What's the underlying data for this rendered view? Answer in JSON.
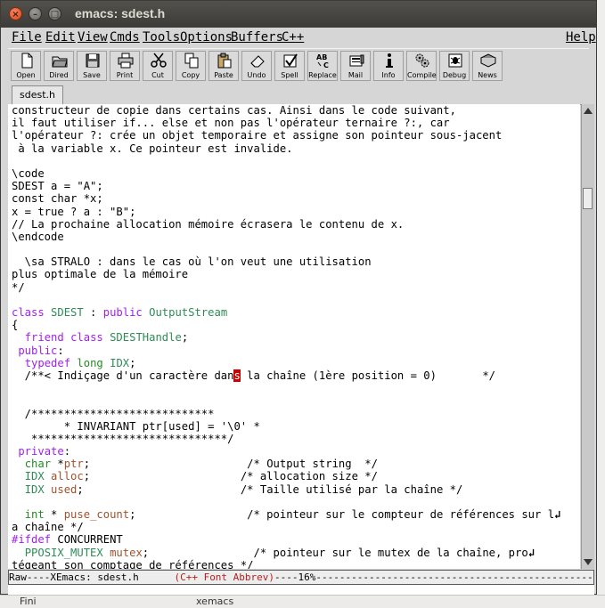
{
  "window": {
    "title": "emacs: sdest.h",
    "close_glyph": "×",
    "min_glyph": "–",
    "max_glyph": "□"
  },
  "menu": [
    {
      "label": "File"
    },
    {
      "label": "Edit"
    },
    {
      "label": "View"
    },
    {
      "label": "Cmds"
    },
    {
      "label": "Tools"
    },
    {
      "label": "Options"
    },
    {
      "label": "Buffers"
    },
    {
      "label": "C++"
    }
  ],
  "menu_help": "Help",
  "toolbar": [
    {
      "label": "Open",
      "icon": "document-icon"
    },
    {
      "label": "Dired",
      "icon": "folder-icon"
    },
    {
      "label": "Save",
      "icon": "floppy-icon"
    },
    {
      "label": "Print",
      "icon": "printer-icon"
    },
    {
      "label": "Cut",
      "icon": "scissors-icon"
    },
    {
      "label": "Copy",
      "icon": "copy-icon"
    },
    {
      "label": "Paste",
      "icon": "clipboard-icon"
    },
    {
      "label": "Undo",
      "icon": "eraser-icon"
    },
    {
      "label": "Spell",
      "icon": "spellcheck-icon"
    },
    {
      "label": "Replace",
      "icon": "replace-icon"
    },
    {
      "label": "Mail",
      "icon": "mail-icon"
    },
    {
      "label": "Info",
      "icon": "info-icon"
    },
    {
      "label": "Compile",
      "icon": "gears-icon"
    },
    {
      "label": "Debug",
      "icon": "bug-icon"
    },
    {
      "label": "News",
      "icon": "news-icon"
    }
  ],
  "tab": {
    "label": "sdest.h"
  },
  "editor": {
    "lines": [
      [
        {
          "t": "constructeur de copie dans certains cas. Ainsi dans le code suivant,"
        }
      ],
      [
        {
          "t": "il faut utiliser if... else et non pas l'opérateur ternaire ?:, car"
        }
      ],
      [
        {
          "t": "l'opérateur ?: crée un objet temporaire et assigne son pointeur sous-jacent"
        }
      ],
      [
        {
          "t": " à la variable x. Ce pointeur est invalide."
        }
      ],
      [
        {
          "t": ""
        }
      ],
      [
        {
          "t": "\\code"
        }
      ],
      [
        {
          "t": "SDEST a = \"A\";"
        }
      ],
      [
        {
          "t": "const char *x;"
        }
      ],
      [
        {
          "t": "x = true ? a : \"B\";"
        }
      ],
      [
        {
          "t": "// La prochaine allocation mémoire écrasera le contenu de x."
        }
      ],
      [
        {
          "t": "\\endcode"
        }
      ],
      [
        {
          "t": ""
        }
      ],
      [
        {
          "t": "  \\sa STRALO : dans le cas où l'on veut une utilisation"
        }
      ],
      [
        {
          "t": "plus optimale de la mémoire"
        }
      ],
      [
        {
          "t": "*/"
        }
      ],
      [
        {
          "t": ""
        }
      ],
      [
        {
          "t": "class",
          "c": "kw"
        },
        {
          "t": " "
        },
        {
          "t": "SDEST",
          "c": "tp"
        },
        {
          "t": " : "
        },
        {
          "t": "public",
          "c": "kw"
        },
        {
          "t": " "
        },
        {
          "t": "OutputStream",
          "c": "tp"
        }
      ],
      [
        {
          "t": "{"
        }
      ],
      [
        {
          "t": "  "
        },
        {
          "t": "friend",
          "c": "kw"
        },
        {
          "t": " "
        },
        {
          "t": "class",
          "c": "kw"
        },
        {
          "t": " "
        },
        {
          "t": "SDESTHandle",
          "c": "tp"
        },
        {
          "t": ";"
        }
      ],
      [
        {
          "t": " "
        },
        {
          "t": "public",
          "c": "kw"
        },
        {
          "t": ":"
        }
      ],
      [
        {
          "t": "  "
        },
        {
          "t": "typedef",
          "c": "kw"
        },
        {
          "t": " "
        },
        {
          "t": "long",
          "c": "ty"
        },
        {
          "t": " "
        },
        {
          "t": "IDX",
          "c": "tp"
        },
        {
          "t": ";"
        }
      ],
      [
        {
          "t": "  /**< Indiçage d'un caractère dan"
        },
        {
          "t": "s",
          "cursor": true
        },
        {
          "t": " la chaîne (1ère position = 0)       */"
        }
      ],
      [
        {
          "t": ""
        }
      ],
      [
        {
          "t": ""
        }
      ],
      [
        {
          "t": "  /****************************"
        }
      ],
      [
        {
          "t": "        * INVARIANT ptr[used] = '\\0' *"
        }
      ],
      [
        {
          "t": "   ******************************/"
        }
      ],
      [
        {
          "t": " "
        },
        {
          "t": "private",
          "c": "kw"
        },
        {
          "t": ":"
        }
      ],
      [
        {
          "t": "  "
        },
        {
          "t": "char",
          "c": "ty"
        },
        {
          "t": " *"
        },
        {
          "t": "ptr",
          "c": "vr"
        },
        {
          "t": ";                        /* Output string  */"
        }
      ],
      [
        {
          "t": "  "
        },
        {
          "t": "IDX",
          "c": "tp"
        },
        {
          "t": " "
        },
        {
          "t": "alloc",
          "c": "vr"
        },
        {
          "t": ";                       /* allocation size */"
        }
      ],
      [
        {
          "t": "  "
        },
        {
          "t": "IDX",
          "c": "tp"
        },
        {
          "t": " "
        },
        {
          "t": "used",
          "c": "vr"
        },
        {
          "t": ";                        /* Taille utilisé par la chaîne */"
        }
      ],
      [
        {
          "t": ""
        }
      ],
      [
        {
          "t": "  "
        },
        {
          "t": "int",
          "c": "ty"
        },
        {
          "t": " * "
        },
        {
          "t": "puse_count",
          "c": "vr"
        },
        {
          "t": ";                 /* pointeur sur le compteur de références sur l"
        },
        {
          "t": "↲",
          "wrap": true
        }
      ],
      [
        {
          "t": "a chaîne */"
        }
      ],
      [
        {
          "t": "#ifdef",
          "c": "kw"
        },
        {
          "t": " CONCURRENT"
        }
      ],
      [
        {
          "t": "  "
        },
        {
          "t": "PPOSIX_MUTEX",
          "c": "tp"
        },
        {
          "t": " "
        },
        {
          "t": "mutex",
          "c": "vr"
        },
        {
          "t": ";                /* pointeur sur le mutex de la chaîne, pro"
        },
        {
          "t": "↲",
          "wrap": true
        }
      ],
      [
        {
          "t": "tégeant son comptage de références */"
        }
      ]
    ]
  },
  "modeline": {
    "buffer_status": "Raw----XEmacs: sdest.h",
    "modes": "(C++ Font Abbrev)",
    "position": "----16%",
    "trailer": "------------------------------------------------"
  },
  "behind": {
    "left_text": "Fini",
    "mid_text": "xemacs"
  },
  "colors": {
    "keyword": "#a020f0",
    "type": "#228b22",
    "typename": "#2e8b57",
    "variable": "#a0522d",
    "cursor": "#cc0000"
  }
}
